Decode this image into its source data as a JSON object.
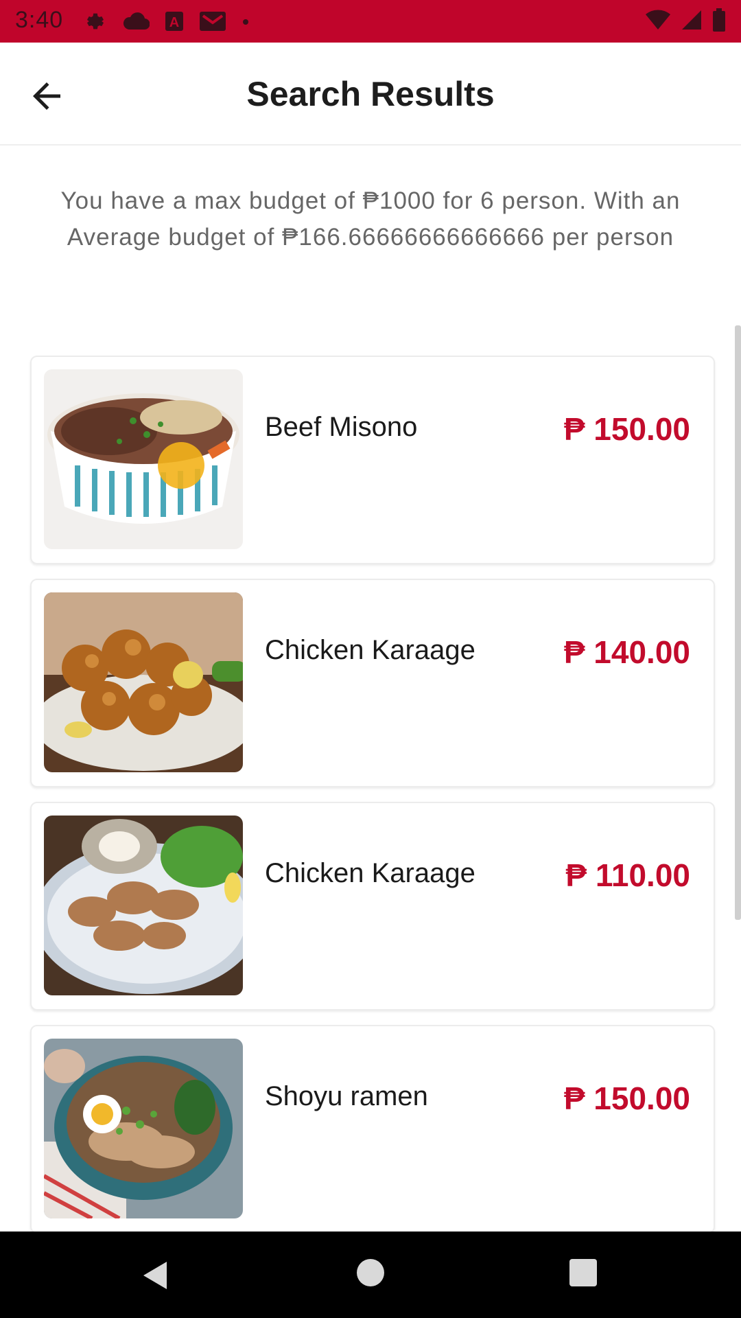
{
  "status_bar": {
    "time": "3:40",
    "left_icons": [
      "settings-icon",
      "cloud-icon",
      "a-icon",
      "gmail-icon",
      "dot-icon"
    ],
    "right_icons": [
      "wifi-icon",
      "signal-icon",
      "battery-icon"
    ],
    "color": "#c0052b"
  },
  "header": {
    "title": "Search Results",
    "back_icon": "arrow-left-icon"
  },
  "budget": {
    "message": "You have a max budget of ₱1000 for 6 person. With an Average budget of ₱166.66666666666666 per person"
  },
  "results": [
    {
      "name": "Beef Misono",
      "price": "₱ 150.00",
      "image": "beef-bowl-image"
    },
    {
      "name": "Chicken Karaage",
      "price": "₱ 140.00",
      "image": "fried-chicken-image"
    },
    {
      "name": "Chicken Karaage",
      "price": "₱ 110.00",
      "image": "chicken-plate-image"
    },
    {
      "name": "Shoyu ramen",
      "price": "₱ 150.00",
      "image": "ramen-bowl-image"
    }
  ],
  "theme": {
    "accent": "#c20b2c"
  },
  "nav_bar": {
    "icons": [
      "back-triangle-icon",
      "home-circle-icon",
      "recents-square-icon"
    ]
  }
}
